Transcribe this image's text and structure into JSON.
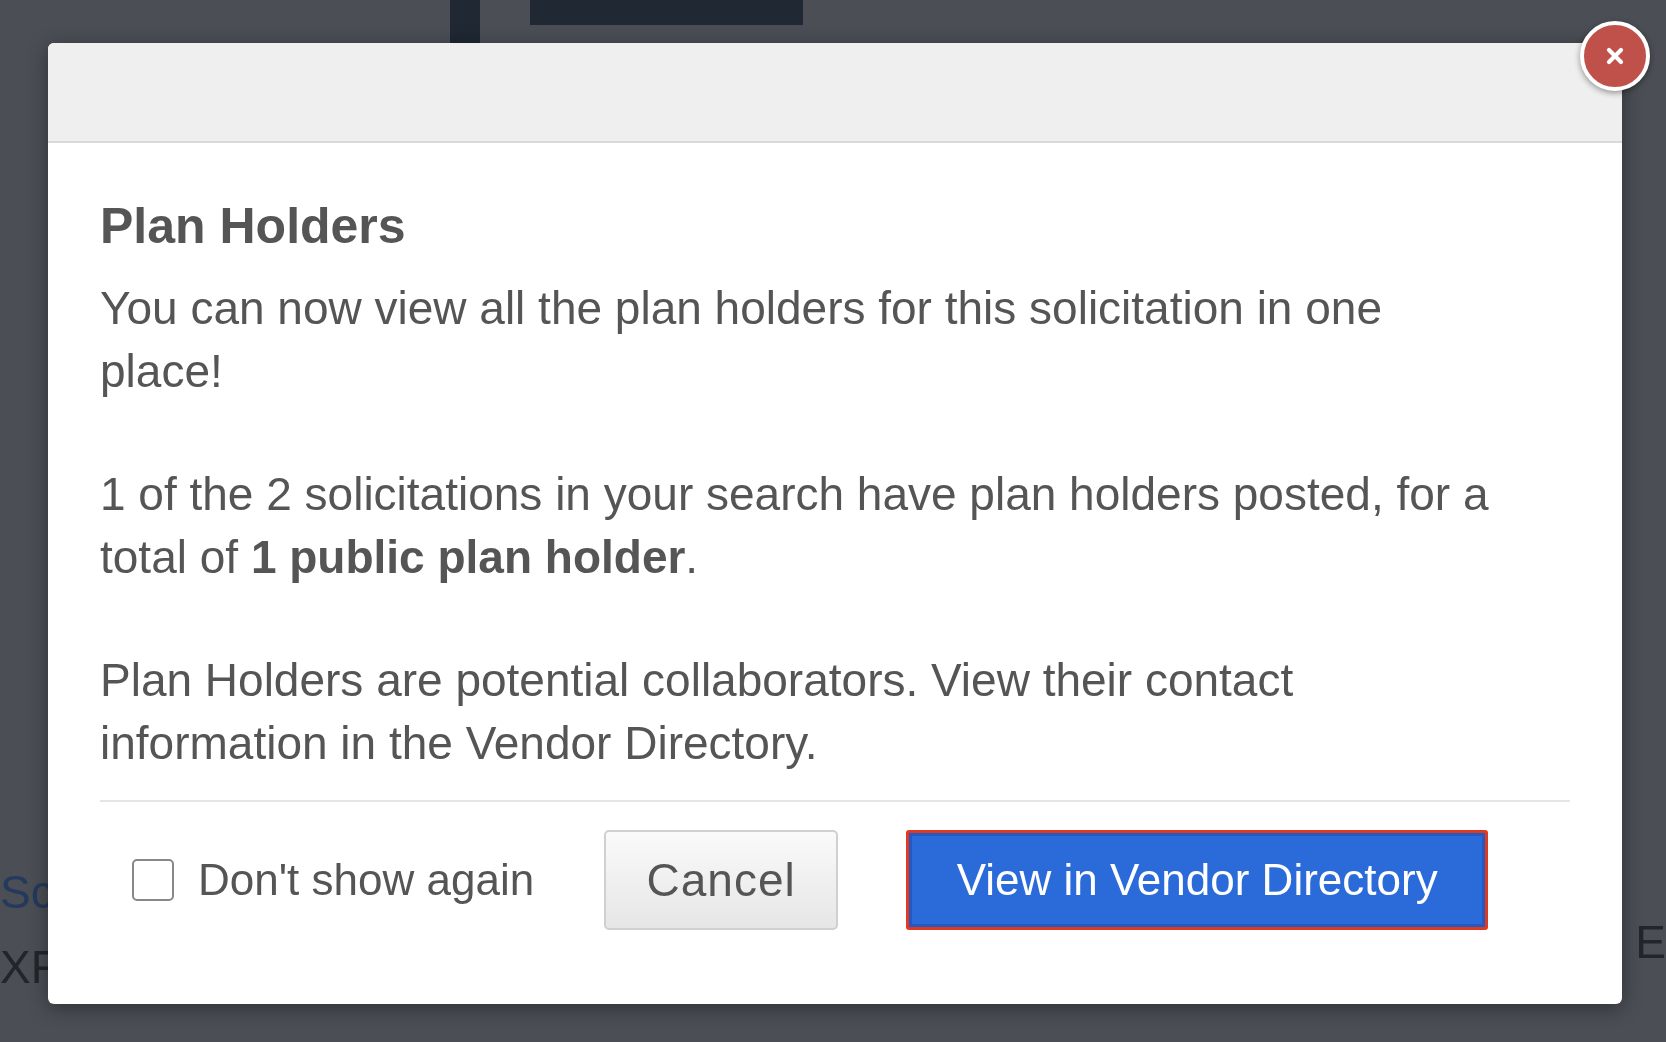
{
  "background": {
    "fragments": [
      {
        "text": "Sc",
        "kind": "link"
      },
      {
        "text": "XF",
        "kind": "plain"
      },
      {
        "text": "E",
        "kind": "plain"
      }
    ]
  },
  "dialog": {
    "title": "Plan Holders",
    "paragraphs": [
      "You can now view all the plan holders for this solicitation in one place!",
      "1 of the 2 solicitations in your search have plan holders posted, for a total of **1 public plan holder**.",
      "Plan Holders are potential collaborators. View their contact information in the Vendor Directory."
    ],
    "dont_show_again": {
      "label": "Don't show again",
      "checked": false
    },
    "cancel_button": "Cancel",
    "primary_button": {
      "label": "View in Vendor Directory",
      "highlighted": true
    }
  }
}
